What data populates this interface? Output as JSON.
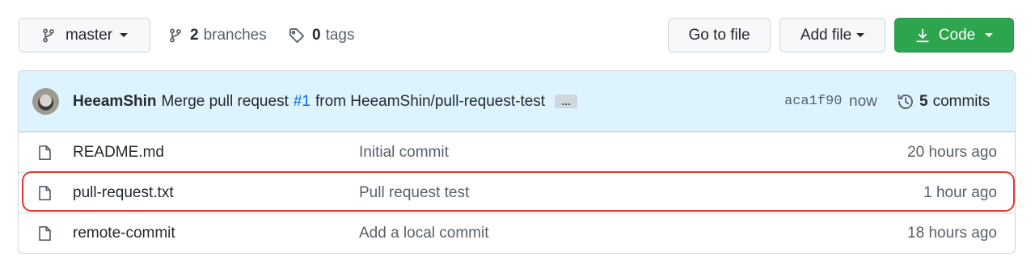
{
  "toolbar": {
    "branch": "master",
    "branches_count": "2",
    "branches_label": "branches",
    "tags_count": "0",
    "tags_label": "tags",
    "goto_file": "Go to file",
    "add_file": "Add file",
    "code": "Code"
  },
  "latest_commit": {
    "author": "HeeamShin",
    "message_prefix": "Merge pull request",
    "pr": "#1",
    "message_suffix": "from HeeamShin/pull-request-test",
    "ellipsis": "…",
    "sha": "aca1f90",
    "time": "now",
    "commits_count": "5",
    "commits_label": "commits"
  },
  "files": [
    {
      "name": "README.md",
      "message": "Initial commit",
      "age": "20 hours ago"
    },
    {
      "name": "pull-request.txt",
      "message": "Pull request test",
      "age": "1 hour ago"
    },
    {
      "name": "remote-commit",
      "message": "Add a local commit",
      "age": "18 hours ago"
    }
  ],
  "colors": {
    "code_button": "#2da44e",
    "commit_bar": "#ddf4ff",
    "highlight": "#e5372a",
    "link": "#0969da"
  },
  "icons": {
    "branch": "git-branch-icon",
    "tag": "tag-icon",
    "download": "download-icon",
    "history": "history-icon",
    "file": "file-icon"
  }
}
